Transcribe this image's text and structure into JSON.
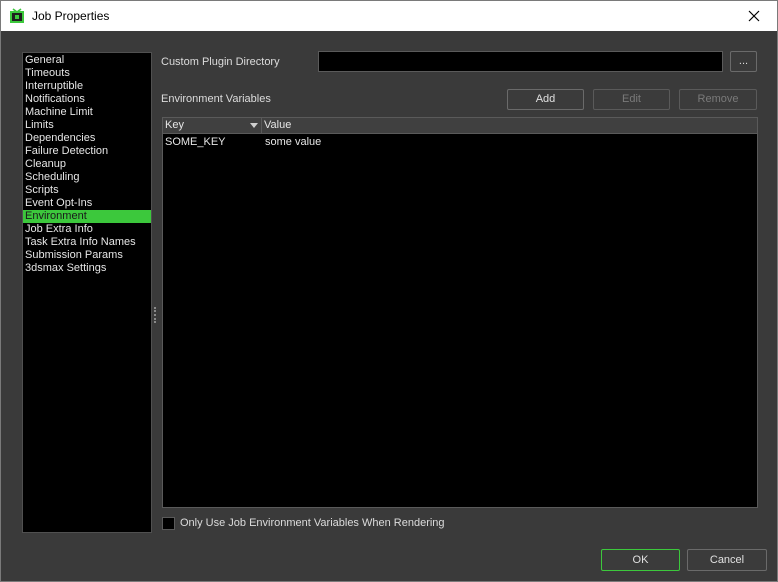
{
  "window": {
    "title": "Job Properties",
    "app_icon": "deadline-monitor-icon",
    "close_icon": "close-icon"
  },
  "sidebar": {
    "selected_index": 13,
    "accent_color": "#3cc83c",
    "items": [
      {
        "label": "General"
      },
      {
        "label": "Timeouts"
      },
      {
        "label": "Interruptible"
      },
      {
        "label": "Notifications"
      },
      {
        "label": "Machine Limit"
      },
      {
        "label": "Limits"
      },
      {
        "label": "Dependencies"
      },
      {
        "label": "Failure Detection"
      },
      {
        "label": "Cleanup"
      },
      {
        "label": "Scheduling"
      },
      {
        "label": "Scripts"
      },
      {
        "label": "Event Opt-Ins"
      },
      {
        "label": "Environment"
      },
      {
        "label": "Job Extra Info"
      },
      {
        "label": "Task Extra Info Names"
      },
      {
        "label": "Submission Params"
      },
      {
        "label": "3dsmax Settings"
      }
    ]
  },
  "plugin_dir": {
    "label": "Custom Plugin Directory",
    "value": "",
    "browse_label": "..."
  },
  "env": {
    "label": "Environment Variables",
    "add_label": "Add",
    "edit_label": "Edit",
    "remove_label": "Remove",
    "columns": {
      "key": "Key",
      "value": "Value"
    },
    "rows": [
      {
        "key": "SOME_KEY",
        "value": "some value"
      }
    ],
    "only_use_label": "Only Use Job Environment Variables When Rendering",
    "only_use_checked": false
  },
  "footer": {
    "ok_label": "OK",
    "cancel_label": "Cancel"
  }
}
